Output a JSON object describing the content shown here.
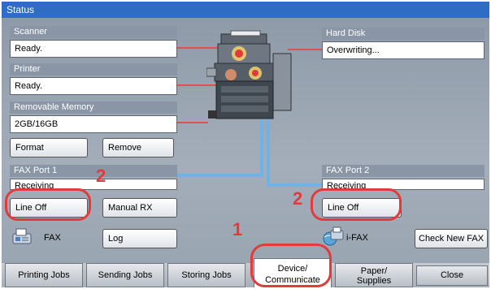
{
  "title": "Status",
  "scanner": {
    "header": "Scanner",
    "value": "Ready."
  },
  "printer": {
    "header": "Printer",
    "value": "Ready."
  },
  "removable_memory": {
    "header": "Removable Memory",
    "value": "2GB/16GB",
    "format_label": "Format",
    "remove_label": "Remove"
  },
  "hard_disk": {
    "header": "Hard Disk",
    "value": "Overwriting..."
  },
  "fax_port1": {
    "header": "FAX Port 1",
    "value": "Receiving",
    "line_off_label": "Line Off",
    "manual_rx_label": "Manual RX"
  },
  "fax_port2": {
    "header": "FAX Port 2",
    "value": "Receiving",
    "line_off_label": "Line Off"
  },
  "fax": {
    "label": "FAX",
    "log_label": "Log"
  },
  "ifax": {
    "label": "i-FAX",
    "check_new_label": "Check New FAX"
  },
  "tabs": [
    {
      "label": "Printing Jobs"
    },
    {
      "label": "Sending Jobs"
    },
    {
      "label": "Storing Jobs"
    },
    {
      "label_line1": "Device/",
      "label_line2": "Communicate"
    },
    {
      "label_line1": "Paper/",
      "label_line2": "Supplies"
    },
    {
      "label": "Close"
    }
  ],
  "annotations": {
    "n1": "1",
    "n2a": "2",
    "n2b": "2"
  },
  "colors": {
    "title_bar": "#2f6cc4",
    "annotation": "#e23b3b",
    "cable": "#6fb2e8",
    "connector": "#e05050"
  },
  "icons": {
    "printer": "multifunction-printer-icon",
    "fax": "fax-icon",
    "ifax": "ifax-globe-icon"
  }
}
